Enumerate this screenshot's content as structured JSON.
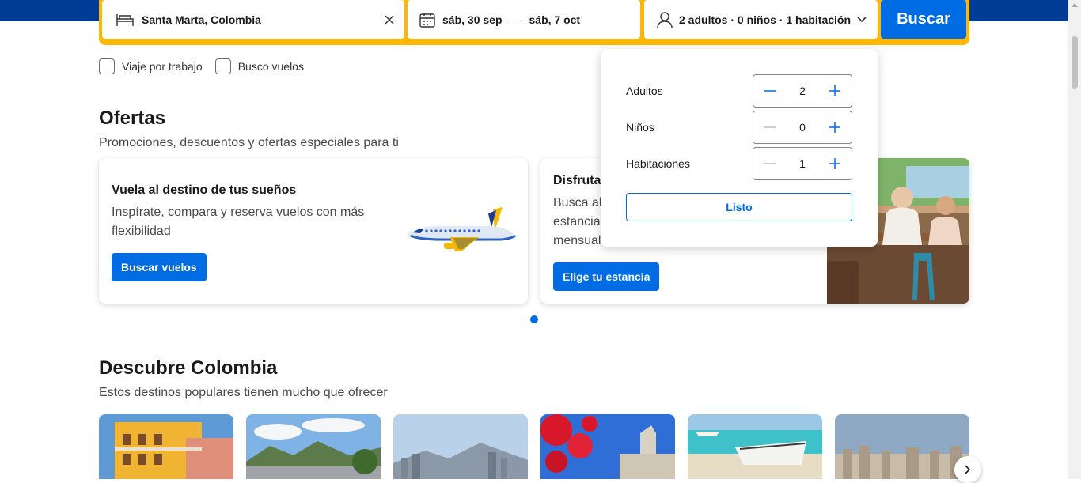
{
  "search": {
    "destination": "Santa Marta, Colombia",
    "check_in": "sáb, 30 sep",
    "date_separator": "—",
    "check_out": "sáb, 7 oct",
    "guests_summary": "2 adultos · 0 niños · 1 habitación",
    "search_label": "Buscar"
  },
  "checkboxes": [
    {
      "label": "Viaje por trabajo",
      "checked": false
    },
    {
      "label": "Busco vuelos",
      "checked": false
    }
  ],
  "offers": {
    "title": "Ofertas",
    "subtitle": "Promociones, descuentos y ofertas especiales para ti",
    "cards": [
      {
        "title": "Vuela al destino de tus sueños",
        "text_line1": "Inspírate, compara y reserva vuelos con más",
        "text_line2": "flexibilidad",
        "button": "Buscar vuelos"
      },
      {
        "title": "Disfruta",
        "text_line1": "Busca alo",
        "text_line2": "estancias",
        "text_line3": "mensual",
        "button": "Elige tu estancia"
      }
    ]
  },
  "discover": {
    "title": "Descubre Colombia",
    "subtitle": "Estos destinos populares tienen mucho que ofrecer"
  },
  "guests_popup": {
    "rows": [
      {
        "label": "Adultos",
        "value": "2"
      },
      {
        "label": "Niños",
        "value": "0"
      },
      {
        "label": "Habitaciones",
        "value": "1"
      }
    ],
    "done_label": "Listo"
  },
  "colors": {
    "header_blue": "#003b95",
    "accent": "#006ce4",
    "search_border": "#ffb700"
  }
}
